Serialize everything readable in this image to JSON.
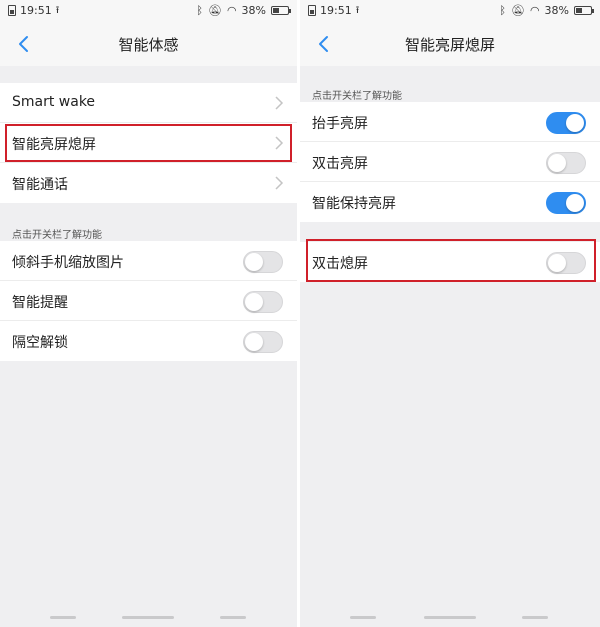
{
  "status": {
    "time": "19:51",
    "battery": "38%"
  },
  "left": {
    "title": "智能体感",
    "nav_items": [
      {
        "label": "Smart wake"
      },
      {
        "label": "智能亮屏熄屏"
      },
      {
        "label": "智能通话"
      }
    ],
    "section_header": "点击开关栏了解功能",
    "toggles": [
      {
        "label": "倾斜手机缩放图片",
        "on": false
      },
      {
        "label": "智能提醒",
        "on": false
      },
      {
        "label": "隔空解锁",
        "on": false
      }
    ]
  },
  "right": {
    "title": "智能亮屏熄屏",
    "section_header": "点击开关栏了解功能",
    "toggles": [
      {
        "label": "抬手亮屏",
        "on": true
      },
      {
        "label": "双击亮屏",
        "on": false
      },
      {
        "label": "智能保持亮屏",
        "on": true
      }
    ],
    "standalone_toggle": {
      "label": "双击熄屏",
      "on": false
    }
  },
  "colors": {
    "accent": "#2f8df0",
    "highlight": "#d0202a"
  },
  "icons": [
    "sim-icon",
    "upload-icon",
    "bluetooth-icon",
    "mute-icon",
    "wifi-icon",
    "battery-icon",
    "back-icon",
    "chevron-right-icon"
  ]
}
